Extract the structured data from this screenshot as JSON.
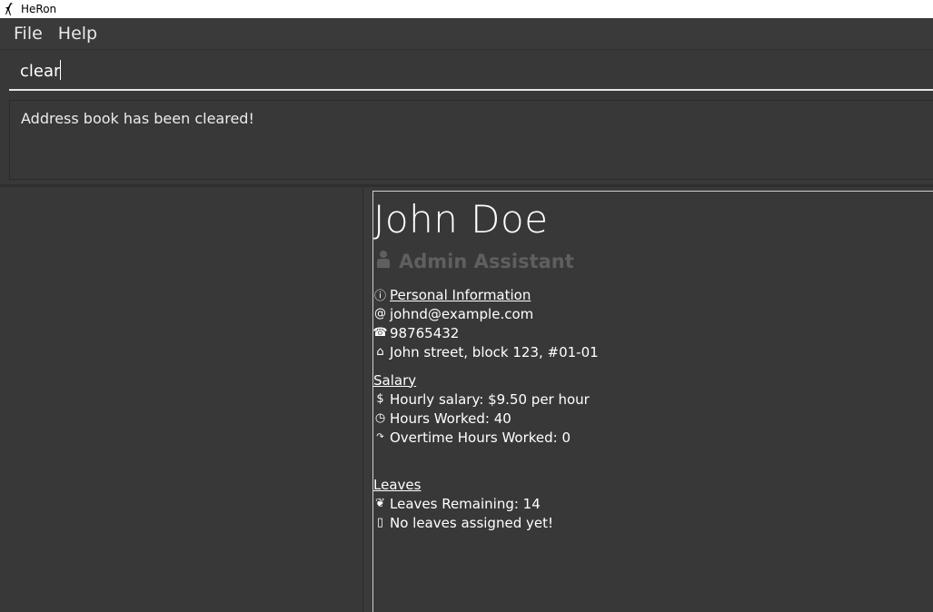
{
  "window": {
    "title": "HeRon"
  },
  "menu": {
    "items": [
      "File",
      "Help"
    ]
  },
  "command_box": {
    "value": "clear"
  },
  "result_display": {
    "message": "Address book has been cleared!"
  },
  "person": {
    "name": "John Doe",
    "role": "Admin Assistant",
    "personal_info": {
      "heading": "Personal Information",
      "email": "johnd@example.com",
      "phone": "98765432",
      "address": "John street, block 123, #01-01"
    },
    "salary": {
      "heading": "Salary",
      "hourly": "Hourly salary: $9.50 per hour",
      "hours_worked": "Hours Worked: 40",
      "overtime": "Overtime Hours Worked: 0"
    },
    "leaves": {
      "heading": "Leaves",
      "remaining": "Leaves Remaining: 14",
      "assigned": "No leaves assigned yet!"
    }
  },
  "icons": {
    "app": "heron-icon",
    "role": "person-icon",
    "info": "info-icon",
    "email": "at-icon",
    "phone": "phone-icon",
    "address": "home-icon",
    "salary": "dollar-icon",
    "hours": "clock-icon",
    "overtime": "overtime-arrow-icon",
    "leaves": "leaf-icon",
    "calendar": "calendar-icon"
  }
}
